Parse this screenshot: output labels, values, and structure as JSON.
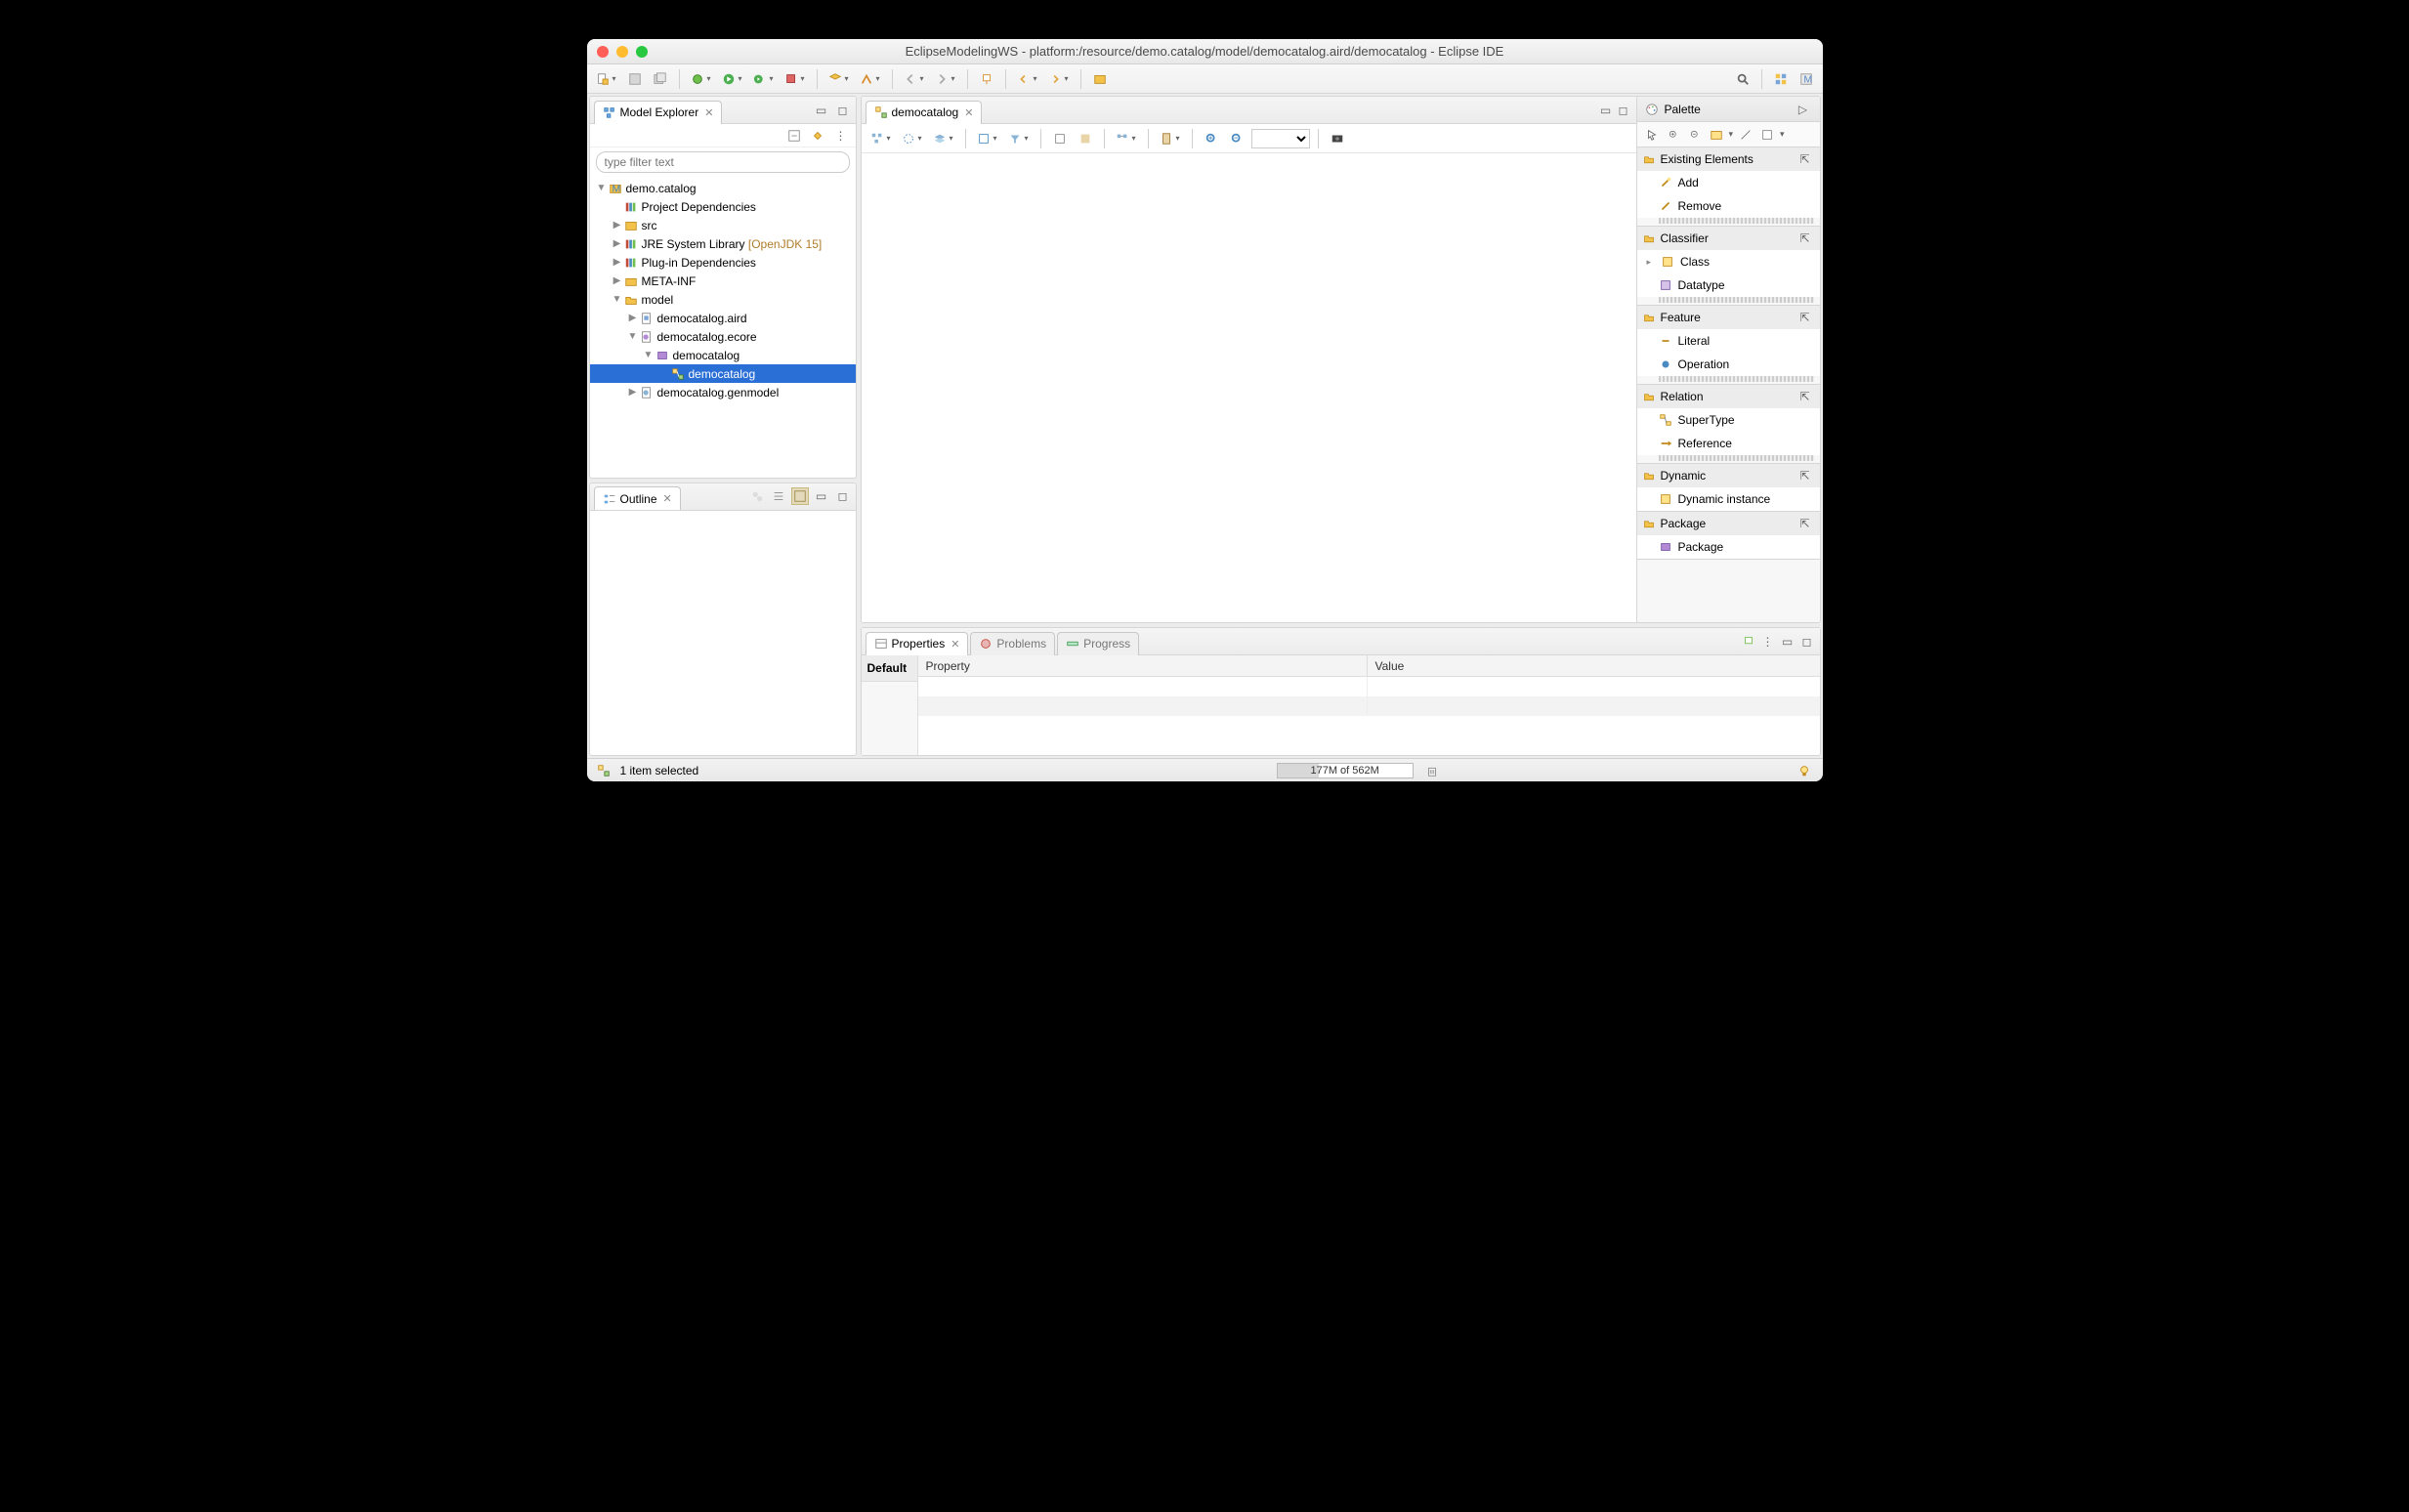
{
  "window": {
    "title": "EclipseModelingWS - platform:/resource/demo.catalog/model/democatalog.aird/democatalog - Eclipse IDE"
  },
  "views": {
    "modelExplorer": {
      "title": "Model Explorer",
      "filterPlaceholder": "type filter text",
      "tree": {
        "root": "demo.catalog",
        "projectDeps": "Project Dependencies",
        "src": "src",
        "jre": "JRE System Library",
        "jreQualifier": "[OpenJDK 15]",
        "pluginDeps": "Plug-in Dependencies",
        "metaInf": "META-INF",
        "model": "model",
        "aird": "democatalog.aird",
        "ecore": "democatalog.ecore",
        "ecorePkg": "democatalog",
        "ecoreSubPkg": "democatalog",
        "genmodel": "democatalog.genmodel"
      }
    },
    "outline": {
      "title": "Outline"
    }
  },
  "editor": {
    "tab": "democatalog"
  },
  "palette": {
    "title": "Palette",
    "sections": {
      "existing": {
        "title": "Existing Elements",
        "items": [
          "Add",
          "Remove"
        ]
      },
      "classifier": {
        "title": "Classifier",
        "items": [
          "Class",
          "Datatype"
        ]
      },
      "feature": {
        "title": "Feature",
        "items": [
          "Literal",
          "Operation"
        ]
      },
      "relation": {
        "title": "Relation",
        "items": [
          "SuperType",
          "Reference"
        ]
      },
      "dynamic": {
        "title": "Dynamic",
        "items": [
          "Dynamic instance"
        ]
      },
      "package": {
        "title": "Package",
        "items": [
          "Package"
        ]
      }
    }
  },
  "bottom": {
    "properties": "Properties",
    "problems": "Problems",
    "progress": "Progress",
    "sideTab": "Default",
    "colProperty": "Property",
    "colValue": "Value"
  },
  "status": {
    "selection": "1 item selected",
    "memory": "177M of 562M",
    "memoryPercent": 31
  }
}
